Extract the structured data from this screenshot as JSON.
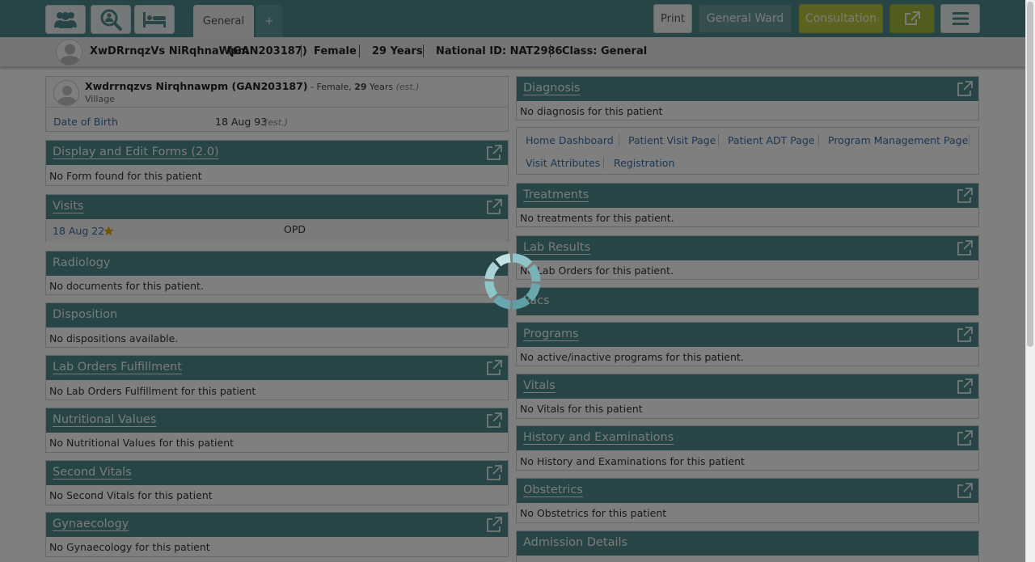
{
  "topbar": {
    "tabs": [
      {
        "label": "General"
      },
      {
        "label": "+"
      }
    ],
    "buttons": {
      "print": "Print",
      "ward": "General Ward",
      "consultation": "Consultation"
    },
    "icons": [
      "users-icon",
      "search-patient-icon",
      "bed-icon",
      "external-link-icon",
      "hamburger-menu-icon"
    ]
  },
  "patient_bar": {
    "name": "XwDRrnqzVs NiRqhnaWpm",
    "id": "(GAN203187)",
    "gender": "Female",
    "age": "29 Years",
    "national_id": "National ID: NAT2986",
    "class": "Class: General"
  },
  "patient_card": {
    "name": "Xwdrrnqzvs Nirqhnawpm (GAN203187)",
    "sep": " - ",
    "gender": "Female, ",
    "age_num": "29",
    "age_unit": " Years ",
    "est": "(est.)",
    "village": "Village",
    "dob_label": "Date of Birth",
    "dob_value": "18 Aug 93",
    "dob_est": "(est.)"
  },
  "left_cards": {
    "forms": {
      "title": "Display and Edit Forms (2.0)",
      "body": "No Form found for this patient"
    },
    "visits": {
      "title": "Visits",
      "date": "18 Aug 22",
      "type": "OPD"
    },
    "radiology": {
      "title": "Radiology",
      "body": "No documents for this patient."
    },
    "disposition": {
      "title": "Disposition",
      "body": "No dispositions available."
    },
    "lab_fulfillment": {
      "title": "Lab Orders Fulfillment",
      "body": "No Lab Orders Fulfillment for this patient"
    },
    "nutritional": {
      "title": "Nutritional Values",
      "body": "No Nutritional Values for this patient"
    },
    "second_vitals": {
      "title": "Second Vitals",
      "body": "No Second Vitals for this patient"
    },
    "gynaecology": {
      "title": "Gynaecology",
      "body": "No Gynaecology for this patient"
    }
  },
  "right_cards": {
    "diagnosis": {
      "title": "Diagnosis",
      "body": "No diagnosis for this patient"
    },
    "links": [
      "Home Dashboard",
      "Patient Visit Page",
      "Patient ADT Page",
      "Program Management Page",
      "Visit Attributes",
      "Registration"
    ],
    "treatments": {
      "title": "Treatments",
      "body": "No treatments for this patient."
    },
    "lab_results": {
      "title": "Lab Results",
      "body": "No Lab Orders for this patient."
    },
    "pacs": {
      "title": "Pacs"
    },
    "programs": {
      "title": "Programs",
      "body": "No active/inactive programs for this patient."
    },
    "vitals": {
      "title": "Vitals",
      "body": "No Vitals for this patient"
    },
    "history": {
      "title": "History and Examinations",
      "body": "No History and Examinations for this patient"
    },
    "obstetrics": {
      "title": "Obstetrics",
      "body": "No Obstetrics for this patient"
    },
    "admission": {
      "title": "Admission Details"
    }
  },
  "colors": {
    "header_teal": "#4f8b8d",
    "consultation": "#b9c742",
    "link_blue": "#3a6fa6",
    "overlay": "rgba(0,0,0,0.5)"
  }
}
